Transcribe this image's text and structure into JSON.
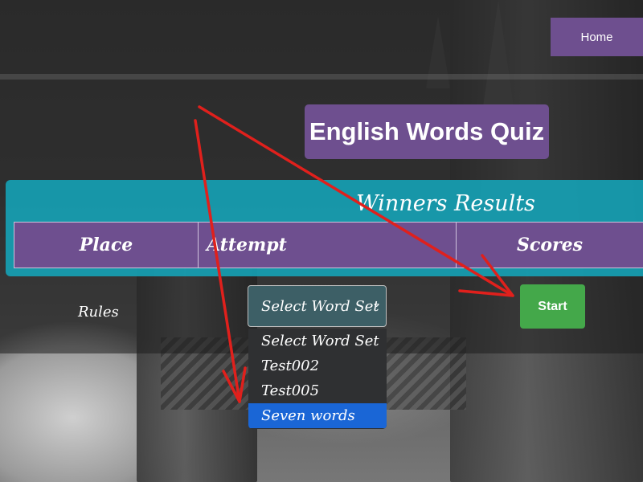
{
  "nav": {
    "home_label": "Home"
  },
  "page": {
    "title": "English Words Quiz"
  },
  "results": {
    "title": "Winners Results",
    "columns": [
      "Place",
      "Attempt",
      "Scores"
    ]
  },
  "controls": {
    "rules_label": "Rules",
    "select_value": "Select Word Set",
    "options": [
      "Select Word Set",
      "Test002",
      "Test005",
      "Seven words"
    ],
    "highlighted_option": "Seven words",
    "start_label": "Start"
  },
  "colors": {
    "purple": "#6e4f8f",
    "teal": "#14a5b9",
    "green": "#44a84a",
    "annotation_red": "#e0201c"
  }
}
